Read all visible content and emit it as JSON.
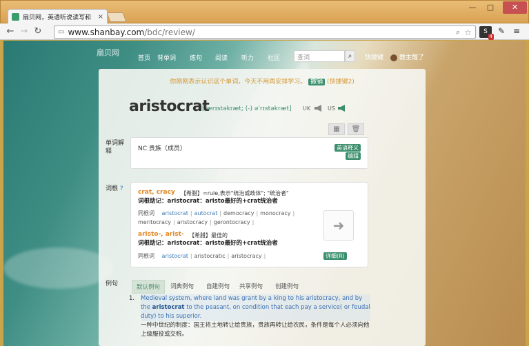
{
  "browser": {
    "tab_title": "扇贝网，英语听说读写和",
    "url_host": "www.shanbay.com",
    "url_path": "/bdc/review/",
    "ext_badge_count": "4"
  },
  "site": {
    "logo": "扇贝网",
    "nav": [
      "首页",
      "背单词",
      "炼句",
      "阅读",
      "听力",
      "社区"
    ],
    "search_placeholder": "查词",
    "shortcut": "快捷键",
    "user": "教主醒了"
  },
  "review": {
    "hint": "你刚刚表示认识这个单词，今天不用再安排学习。",
    "hint_btn": "撤销",
    "hint_key": "(快捷键2)",
    "word": "aristocrat",
    "phonetic": "[ˈærɪstəkræt; (-) əˈrɪstəkræt]",
    "uk": "UK",
    "us": "US"
  },
  "definition": {
    "label": "单词解释",
    "text": "NC 贵族（成员）",
    "en_btn": "英语释义",
    "edit_btn": "编辑"
  },
  "roots": {
    "label": "词根",
    "blocks": [
      {
        "title": "crat, cracy",
        "note": "【希腊】=rule,表示\"统治或政体\"; \"统治者\"",
        "mem": "词根助记：aristocrat：aristo最好的+crat统治者",
        "related_label": "同根词",
        "related": [
          "aristocrat",
          "autocrat",
          "democracy",
          "monocracy",
          "meritocracy",
          "aristocracy",
          "gerontocracy"
        ]
      },
      {
        "title": "aristo-, arist-",
        "note": "【希腊】最佳的",
        "mem": "词根助记：aristocrat：aristo最好的+crat统治者",
        "related_label": "同根词",
        "related": [
          "aristocrat",
          "aristocratic",
          "aristocracy"
        ]
      }
    ],
    "detail_btn": "详细(R)"
  },
  "examples": {
    "label": "例句",
    "tabs": [
      "默认例句",
      "词典例句",
      "自建例句",
      "共享例句",
      "创建例句"
    ],
    "items": [
      {
        "num": "1.",
        "en_pre": "Medieval system, where land was grant by a king to his aristocracy, and by the",
        "en_word": "aristocrat",
        "en_post": "to the peasant, on condition that each pay a service( or feudal duty) to his superior.",
        "zh": "一种中世纪的制度：国王将土地转让给贵族，贵族再转让给农民，条件是每个人必须向他上级服役或交税。"
      }
    ]
  }
}
